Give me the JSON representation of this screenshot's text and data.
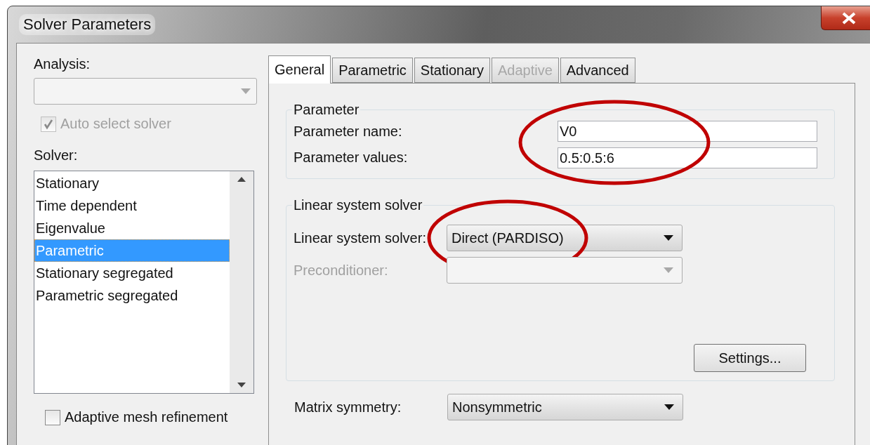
{
  "window": {
    "title": "Solver Parameters"
  },
  "analysis": {
    "label": "Analysis:",
    "disabled": true
  },
  "auto_select": {
    "label": "Auto select solver",
    "checked": true,
    "disabled": true
  },
  "solver": {
    "label": "Solver:",
    "items": [
      {
        "label": "Stationary",
        "selected": false
      },
      {
        "label": "Time dependent",
        "selected": false
      },
      {
        "label": "Eigenvalue",
        "selected": false
      },
      {
        "label": "Parametric",
        "selected": true
      },
      {
        "label": "Stationary segregated",
        "selected": false
      },
      {
        "label": "Parametric segregated",
        "selected": false
      }
    ]
  },
  "adaptive_mesh": {
    "label": "Adaptive mesh refinement",
    "checked": false,
    "disabled": false
  },
  "tabs": [
    {
      "label": "General",
      "selected": true,
      "disabled": false
    },
    {
      "label": "Parametric",
      "selected": false,
      "disabled": false
    },
    {
      "label": "Stationary",
      "selected": false,
      "disabled": false
    },
    {
      "label": "Adaptive",
      "selected": false,
      "disabled": true
    },
    {
      "label": "Advanced",
      "selected": false,
      "disabled": false
    }
  ],
  "parameter": {
    "title": "Parameter",
    "circled": true,
    "fields": [
      {
        "label": "Parameter name:",
        "value": "V0"
      },
      {
        "label": "Parameter values:",
        "value": "0.5:0.5:6"
      }
    ]
  },
  "linear": {
    "title": "Linear system solver",
    "solver": {
      "label": "Linear system solver:",
      "value": "Direct (PARDISO)",
      "disabled": false,
      "circled": true
    },
    "preconditioner": {
      "label": "Preconditioner:",
      "disabled": true
    },
    "settings_button": "Settings..."
  },
  "matrix_symmetry": {
    "label": "Matrix symmetry:",
    "value": "Nonsymmetric",
    "disabled": false
  }
}
